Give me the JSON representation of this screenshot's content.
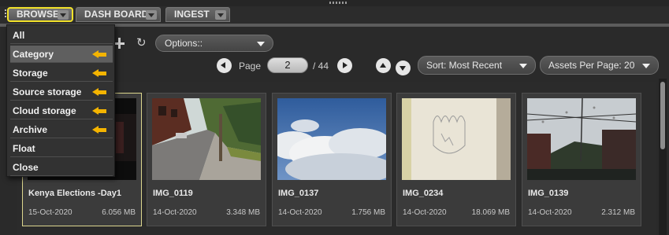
{
  "tabs": [
    {
      "label": "BROWSE",
      "active": true
    },
    {
      "label": "DASH BOARD",
      "active": false
    },
    {
      "label": "INGEST",
      "active": false
    }
  ],
  "menu": {
    "items": [
      {
        "label": "All",
        "arrow": false
      },
      {
        "label": "Category",
        "arrow": true
      },
      {
        "label": "Storage",
        "arrow": true
      },
      {
        "label": "Source storage",
        "arrow": true
      },
      {
        "label": "Cloud storage",
        "arrow": true
      },
      {
        "label": "Archive",
        "arrow": true
      },
      {
        "label": "Float",
        "arrow": false
      },
      {
        "label": "Close",
        "arrow": false
      }
    ],
    "arrow_color": "#f4b400"
  },
  "toolbar": {
    "options_label": "Options::",
    "page_label": "Page",
    "page_value": "2",
    "page_total": "/ 44",
    "sort_label": "Sort: Most Recent",
    "per_page_label": "Assets Per Page: 20"
  },
  "assets": [
    {
      "name": "Kenya Elections -Day1",
      "date": "15-Oct-2020",
      "size": "6.056 MB",
      "thumb": "dark-video"
    },
    {
      "name": "IMG_0119",
      "date": "14-Oct-2020",
      "size": "3.348 MB",
      "thumb": "street"
    },
    {
      "name": "IMG_0137",
      "date": "14-Oct-2020",
      "size": "1.756 MB",
      "thumb": "sky"
    },
    {
      "name": "IMG_0234",
      "date": "14-Oct-2020",
      "size": "18.069 MB",
      "thumb": "paper-sketch"
    },
    {
      "name": "IMG_0139",
      "date": "14-Oct-2020",
      "size": "2.312 MB",
      "thumb": "rainy-window"
    }
  ],
  "colors": {
    "active_tab_border": "#f2e22a",
    "selected_card_border": "#dcd68e"
  }
}
